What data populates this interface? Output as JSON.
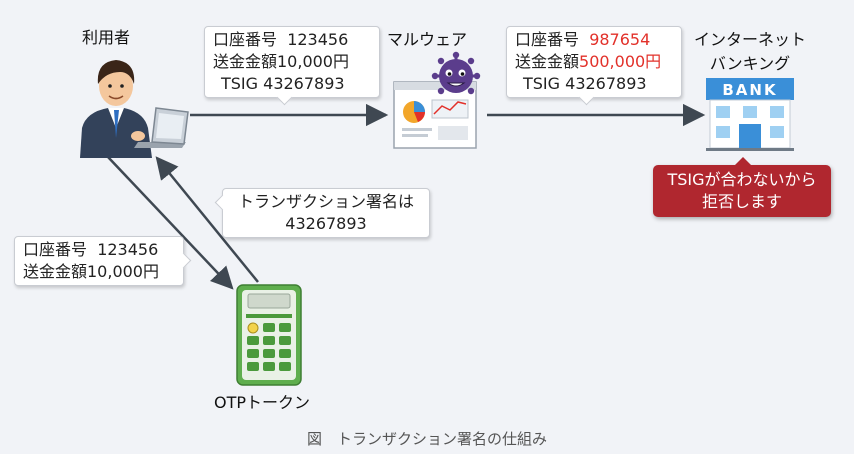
{
  "actors": {
    "user_label": "利用者",
    "malware_label": "マルウェア",
    "bank_label_line1": "インターネット",
    "bank_label_line2": "バンキング",
    "bank_sign": "BANK",
    "token_label": "OTPトークン"
  },
  "bubble_user_to_malware": {
    "line1_key": "口座番号",
    "line1_value": "123456",
    "line2": "送金金額10,000円",
    "line3": "TSIG 43267893"
  },
  "bubble_malware_to_bank": {
    "line1_key": "口座番号",
    "line1_value": "987654",
    "line2_key": "送金金額",
    "line2_value": "500,000円",
    "line3": "TSIG 43267893"
  },
  "bubble_user_to_token": {
    "line1_key": "口座番号",
    "line1_value": "123456",
    "line2": "送金金額10,000円"
  },
  "bubble_token_to_user": {
    "line1": "トランザクション署名は",
    "line2": "43267893"
  },
  "warning": {
    "line1": "TSIGが合わないから",
    "line2": "拒否します"
  },
  "caption": "図　トランザクション署名の仕組み",
  "colors": {
    "background": "#f1f3f7",
    "alert_red": "#e2312a",
    "warning_box": "#b0272f",
    "bank_blue": "#3a8fd8",
    "token_green": "#4b9a3c",
    "malware_purple": "#5b3d8c"
  }
}
